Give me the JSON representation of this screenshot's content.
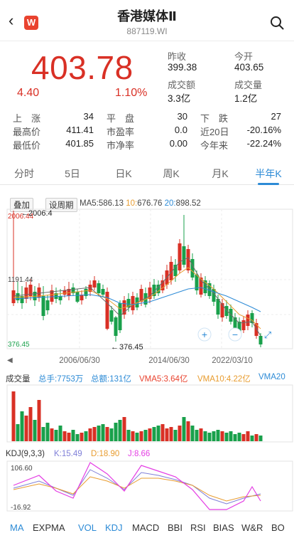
{
  "nav": {
    "title": "香港媒体Ⅱ",
    "code": "887119.WI",
    "logo": "W"
  },
  "quote": {
    "price": "403.78",
    "change": "4.40",
    "change_pct": "1.10%"
  },
  "fields": [
    {
      "label": "昨收",
      "value": "399.38"
    },
    {
      "label": "今开",
      "value": "403.65"
    },
    {
      "label": "成交额",
      "value": "3.3亿"
    },
    {
      "label": "成交量",
      "value": "1.2亿"
    }
  ],
  "stats": [
    {
      "l1": "上　涨",
      "v1": "34",
      "l2": "平　盘",
      "v2": "30",
      "l3": "下　跌",
      "v3": "27"
    },
    {
      "l1": "最高价",
      "v1": "411.41",
      "l2": "市盈率",
      "v2": "0.0",
      "l3": "近20日",
      "v3": "-20.16%"
    },
    {
      "l1": "最低价",
      "v1": "401.85",
      "l2": "市净率",
      "v2": "0.00",
      "l3": "今年来",
      "v3": "-22.24%"
    }
  ],
  "tabs": [
    "分时",
    "5日",
    "日K",
    "周K",
    "月K",
    "半年K"
  ],
  "active_tab": 5,
  "kline": {
    "btn_overlay": "叠加",
    "btn_period": "设周期",
    "ma_prefix": "MA",
    "ma5_label": "5:",
    "ma5_value": "586.13",
    "ma10_label": "10:",
    "ma10_value": "676.76",
    "ma20_label": "20:",
    "ma20_value": "898.52",
    "y_top": "2006.44",
    "y_mid": "1191.44",
    "y_bottom": "376.45",
    "max_note": "2006.4",
    "min_note": "376.45",
    "x_labels": [
      "2006/06/30",
      "2014/06/30",
      "2022/03/10"
    ]
  },
  "volume": {
    "title": "成交量",
    "total_hands": "总手:7753万",
    "total_amount": "总额:131亿",
    "vma5": "VMA5:3.64亿",
    "vma10": "VMA10:4.22亿",
    "vma20": "VMA20"
  },
  "kdj": {
    "title": "KDJ(9,3,3)",
    "k": "K:15.49",
    "d": "D:18.90",
    "j": "J:8.66",
    "y_top": "106.60",
    "y_bottom": "-16.92"
  },
  "indicators": [
    "MA",
    "EXPMA",
    "VOL",
    "KDJ",
    "MACD",
    "BBI",
    "RSI",
    "BIAS",
    "W&R",
    "BO"
  ],
  "colors": {
    "up": "#d93025",
    "down": "#19a04b",
    "accent": "#2d8bd6",
    "ma5": "#6b6b6b",
    "ma10": "#e89c2f",
    "ma20": "#2d8bd6",
    "k": "#7f7fd8",
    "d": "#e89c2f",
    "j": "#e43ee4"
  }
}
